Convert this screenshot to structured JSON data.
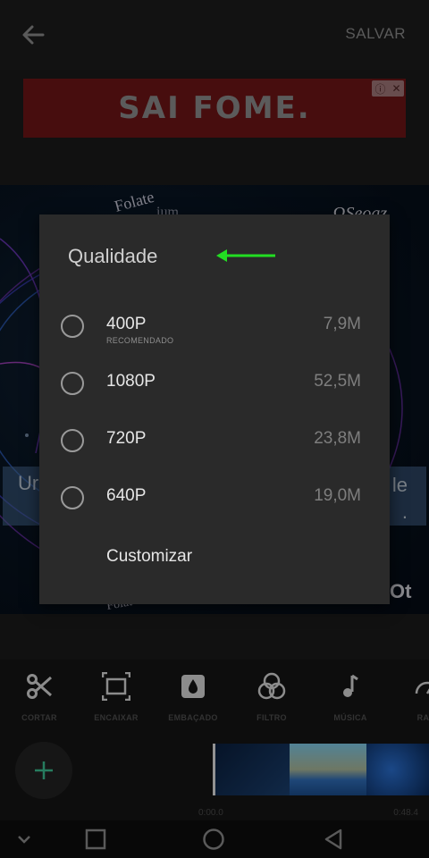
{
  "topbar": {
    "save_label": "SALVAR"
  },
  "ad": {
    "text": "SAI FOME."
  },
  "preview": {
    "caption_left": "Ur",
    "caption_right_line1": "le",
    "caption_right_line2": "."
  },
  "dialog": {
    "title": "Qualidade",
    "options": [
      {
        "label": "400P",
        "sublabel": "RECOMENDADO",
        "size": "7,9M"
      },
      {
        "label": "1080P",
        "sublabel": "",
        "size": "52,5M"
      },
      {
        "label": "720P",
        "sublabel": "",
        "size": "23,8M"
      },
      {
        "label": "640P",
        "sublabel": "",
        "size": "19,0M"
      }
    ],
    "customize_label": "Customizar"
  },
  "toolbar": {
    "items": [
      {
        "label": "CORTAR",
        "icon": "scissors-icon"
      },
      {
        "label": "ENCAIXAR",
        "icon": "fit-frame-icon"
      },
      {
        "label": "EMBAÇADO",
        "icon": "blur-drop-icon"
      },
      {
        "label": "FILTRO",
        "icon": "filter-circles-icon"
      },
      {
        "label": "MÚSICA",
        "icon": "music-note-icon"
      },
      {
        "label": "RAPI",
        "icon": "speed-gauge-icon"
      }
    ]
  },
  "timeline": {
    "start_time": "0:00.0",
    "end_time": "0:48.4"
  },
  "colors": {
    "accent": "#3bbf93",
    "annotation_arrow": "#22dd22",
    "dialog_bg": "#2a2a2a"
  }
}
